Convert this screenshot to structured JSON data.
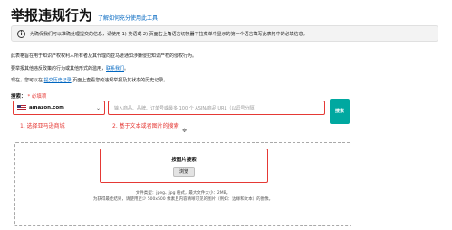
{
  "header": {
    "title": "举报违规行为",
    "help_link": "了解如何充分使用此工具"
  },
  "info_banner": {
    "icon": "info-icon",
    "text": "为确保我们可以准确处理提交的信息，请使用 1) 英语或 2) 页面右上角语言切换器下拉菜单中显示的第一个语言填写此表格中的必填信息。"
  },
  "paragraphs": {
    "p1": "此表格旨在用于知识产权权利人所有者及其代理向亚马逊通知涉嫌侵犯知识产权的侵权行为。",
    "p2_prefix": "要举报其他违反政策的行为或其他形式的滥用，",
    "p2_link": "联系我们",
    "p2_suffix": "。",
    "p3_prefix": "现在，您可以在 ",
    "p3_link": "提交历史记录",
    "p3_suffix": " 页面上查看您的违规举报及其状态的历史记录。"
  },
  "search": {
    "label": "搜索：",
    "label_required": "* 必填项",
    "marketplace_value": "amazon.com",
    "input_placeholder": "输入商品、品牌、订单号或最多 100 个 ASIN/商品 URL（以逗号分隔）",
    "button_label": "搜索"
  },
  "annotations": {
    "first": "1. 选择亚马逊商城",
    "second": "2. 基于文本或者图片的搜索"
  },
  "image_search": {
    "title": "按图片搜索",
    "browse_label": "浏览",
    "note_line1": "文件类型：jpeg、jpg 格式，最大文件大小：2MB。",
    "note_line2": "为获得最佳结果，请使用至少 500x500 像素且内容清晰可见的图片（例如：边缘和文本）的图像。"
  },
  "colors": {
    "annotation_red": "#e53935",
    "search_button": "#00a8a0",
    "link_blue": "#0066c0"
  }
}
